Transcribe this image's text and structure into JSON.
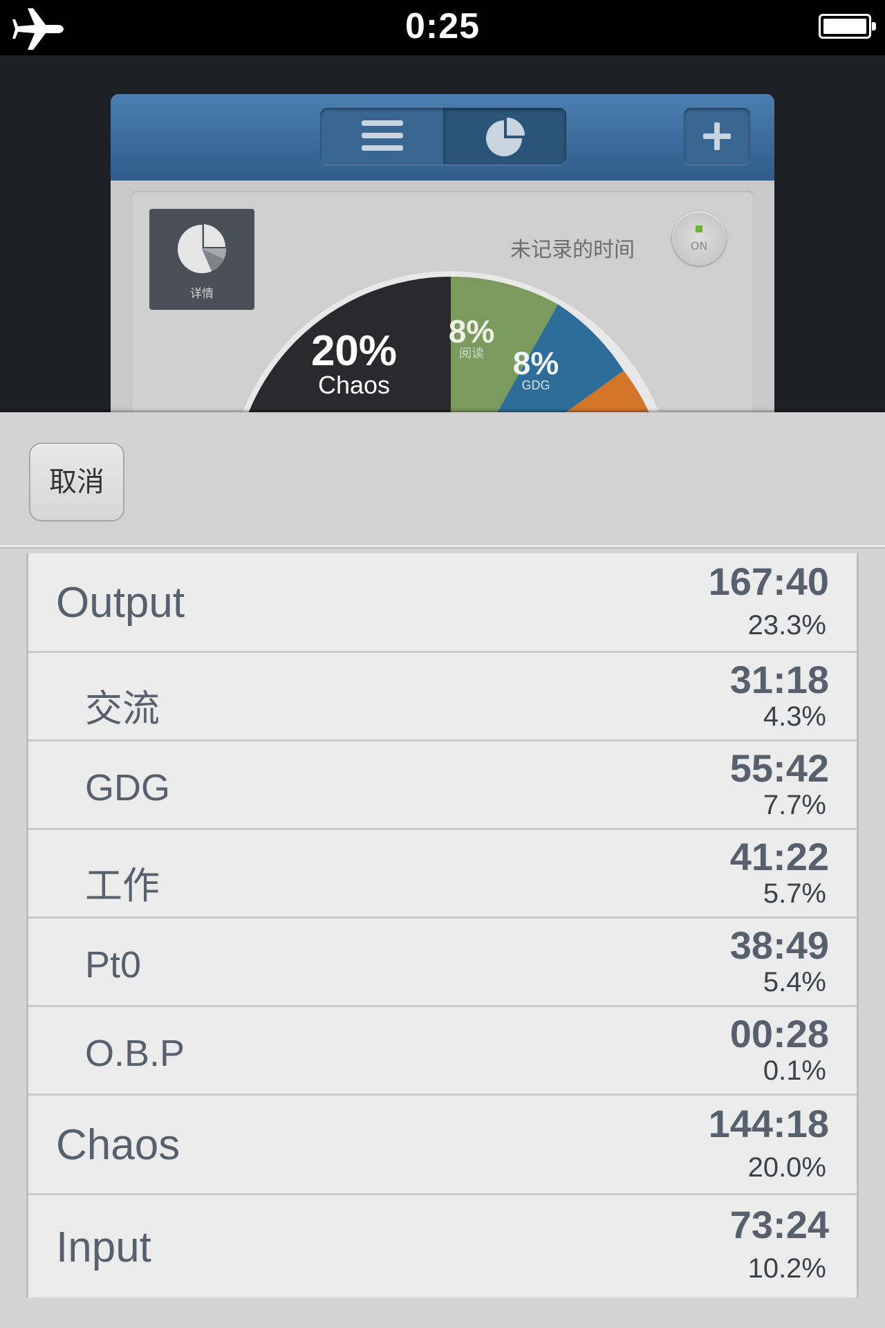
{
  "status_bar": {
    "time": "0:25"
  },
  "background_app": {
    "detail_label": "详情",
    "unrecorded_label": "未记录的时间",
    "toggle_label": "ON",
    "pie_labels": [
      {
        "percent": "20%",
        "name": "Chaos"
      },
      {
        "percent": "8%",
        "name": "阅读"
      },
      {
        "percent": "8%",
        "name": "GDG"
      }
    ]
  },
  "sheet": {
    "cancel_label": "取消",
    "rows": [
      {
        "name": "Output",
        "time": "167:40",
        "percent": "23.3%",
        "level": "top"
      },
      {
        "name": "交流",
        "time": "31:18",
        "percent": "4.3%",
        "level": "sub"
      },
      {
        "name": "GDG",
        "time": "55:42",
        "percent": "7.7%",
        "level": "sub"
      },
      {
        "name": "工作",
        "time": "41:22",
        "percent": "5.7%",
        "level": "sub"
      },
      {
        "name": "Pt0",
        "time": "38:49",
        "percent": "5.4%",
        "level": "sub"
      },
      {
        "name": "O.B.P",
        "time": "00:28",
        "percent": "0.1%",
        "level": "sub"
      },
      {
        "name": "Chaos",
        "time": "144:18",
        "percent": "20.0%",
        "level": "top"
      },
      {
        "name": "Input",
        "time": "73:24",
        "percent": "10.2%",
        "level": "top"
      }
    ]
  },
  "colors": {
    "chaos": "#2a2a2c",
    "reading": "#7a9a5e",
    "gdg": "#2e6c9a",
    "orange": "#d3762a",
    "toolbar": "#3a6791"
  }
}
